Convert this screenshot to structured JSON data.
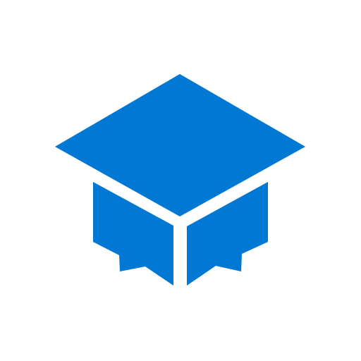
{
  "logo": {
    "icon": "graduation-cap-icon",
    "fill_color": "#0078D4",
    "background_color": "#FFFFFF"
  }
}
